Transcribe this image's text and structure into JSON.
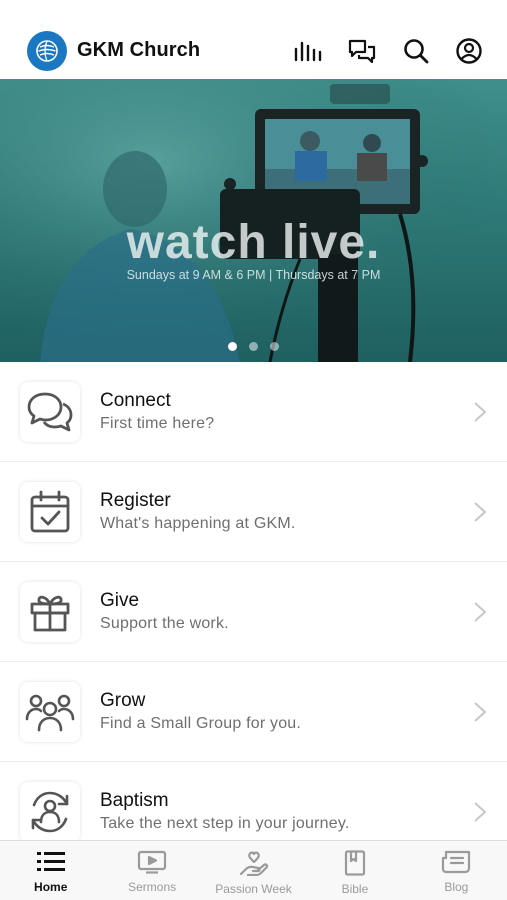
{
  "header": {
    "app_title": "GKM Church",
    "icons": [
      "podcast-bars-icon",
      "chat-bubbles-icon",
      "search-icon",
      "account-icon"
    ]
  },
  "hero": {
    "title": "watch live.",
    "subtitle": "Sundays at 9 AM & 6 PM | Thursdays at 7 PM",
    "slide_count": 3,
    "active_slide": 1
  },
  "menu": {
    "items": [
      {
        "title": "Connect",
        "subtitle": "First time here?",
        "icon": "chat-bubbles-icon"
      },
      {
        "title": "Register",
        "subtitle": "What's happening at GKM.",
        "icon": "calendar-check-icon"
      },
      {
        "title": "Give",
        "subtitle": "Support the work.",
        "icon": "gift-icon"
      },
      {
        "title": "Grow",
        "subtitle": "Find a Small Group for you.",
        "icon": "group-icon"
      },
      {
        "title": "Baptism",
        "subtitle": "Take the next step in your journey.",
        "icon": "baptism-icon"
      }
    ]
  },
  "tabs": [
    {
      "label": "Home",
      "icon": "list-icon",
      "active": true
    },
    {
      "label": "Sermons",
      "icon": "video-icon",
      "active": false
    },
    {
      "label": "Passion Week",
      "icon": "hand-heart-icon",
      "active": false
    },
    {
      "label": "Bible",
      "icon": "book-icon",
      "active": false
    },
    {
      "label": "Blog",
      "icon": "article-icon",
      "active": false
    }
  ],
  "colors": {
    "logo_blue": "#1a78c2",
    "hero_teal": "#2e7a78",
    "icon_gray": "#555555",
    "tab_inactive": "#9a9a9a",
    "tab_active": "#111111"
  }
}
